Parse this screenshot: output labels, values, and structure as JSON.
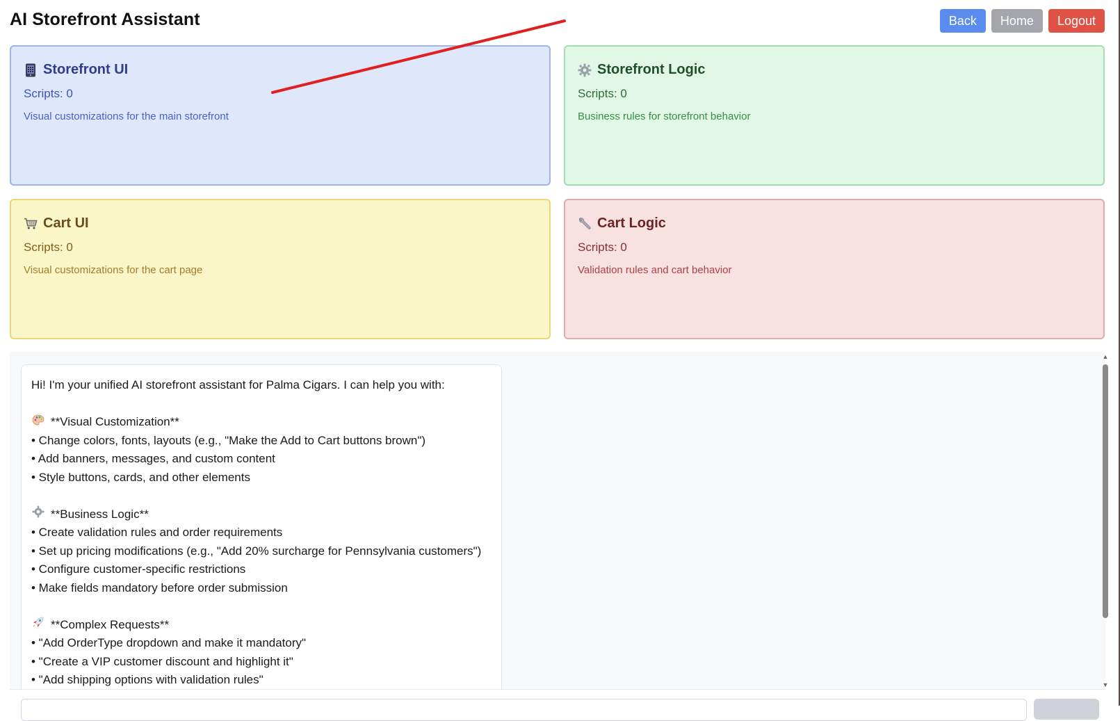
{
  "header": {
    "title": "AI Storefront Assistant"
  },
  "nav": {
    "back": "Back",
    "home": "Home",
    "logout": "Logout"
  },
  "cards": [
    {
      "icon": "phone-icon",
      "title": "Storefront UI",
      "scripts": "Scripts: 0",
      "desc": "Visual customizations for the main storefront"
    },
    {
      "icon": "gear-icon",
      "title": "Storefront Logic",
      "scripts": "Scripts: 0",
      "desc": "Business rules for storefront behavior"
    },
    {
      "icon": "cart-icon",
      "title": "Cart UI",
      "scripts": "Scripts: 0",
      "desc": "Visual customizations for the cart page"
    },
    {
      "icon": "wrench-icon",
      "title": "Cart Logic",
      "scripts": "Scripts: 0",
      "desc": "Validation rules and cart behavior"
    }
  ],
  "chat": {
    "message": {
      "intro": "Hi! I'm your unified AI storefront assistant for Palma Cigars. I can help you with:",
      "visual_heading": "**Visual Customization**",
      "visual_items": [
        "• Change colors, fonts, layouts (e.g., \"Make the Add to Cart buttons brown\")",
        "• Add banners, messages, and custom content",
        "• Style buttons, cards, and other elements"
      ],
      "logic_heading": "**Business Logic**",
      "logic_items": [
        "• Create validation rules and order requirements",
        "• Set up pricing modifications (e.g., \"Add 20% surcharge for Pennsylvania customers\")",
        "• Configure customer-specific restrictions",
        "• Make fields mandatory before order submission"
      ],
      "complex_heading": "**Complex Requests**",
      "complex_items": [
        "• \"Add OrderType dropdown and make it mandatory\"",
        "• \"Create a VIP customer discount and highlight it\"",
        "• \"Add shipping options with validation rules\""
      ]
    }
  },
  "colors": {
    "annotation": "#e02020",
    "back": "#5a8bef",
    "home": "#a3a6ad",
    "logout": "#df5346"
  }
}
